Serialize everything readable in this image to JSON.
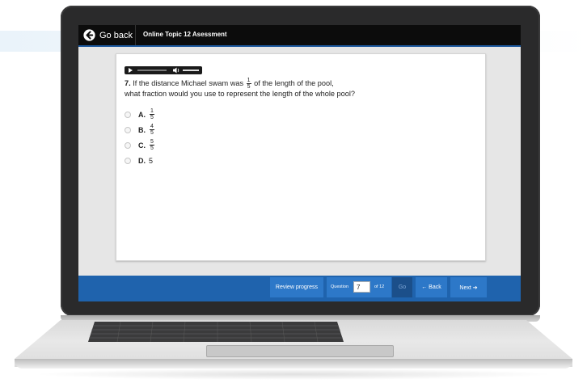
{
  "header": {
    "go_back_label": "Go back",
    "title": "Online Topic 12 Asessment"
  },
  "question": {
    "number": "7.",
    "text_part1": "If the distance Michael swam was",
    "fraction": {
      "num": "1",
      "den": "5"
    },
    "text_part2": "of the length of the pool,",
    "text_line2": "what fraction would you use to represent the length of the whole pool?"
  },
  "options": [
    {
      "letter": "A.",
      "num": "1",
      "den": "5"
    },
    {
      "letter": "B.",
      "num": "4",
      "den": "5"
    },
    {
      "letter": "C.",
      "num": "5",
      "den": "5"
    },
    {
      "letter": "D.",
      "value": "5"
    }
  ],
  "footer": {
    "review_label": "Review progress",
    "question_label": "Question",
    "current_question": "7",
    "of_label": "of 12",
    "go_label": "Go",
    "back_label": "← Back",
    "next_label": "Next ➔"
  },
  "colors": {
    "accent": "#1f63ad",
    "button": "#2d78c8",
    "topbar": "#0c0c0c"
  },
  "icons": {
    "go_back": "arrow-left-circle-icon",
    "audio_play": "play-icon",
    "audio_volume": "speaker-icon"
  }
}
